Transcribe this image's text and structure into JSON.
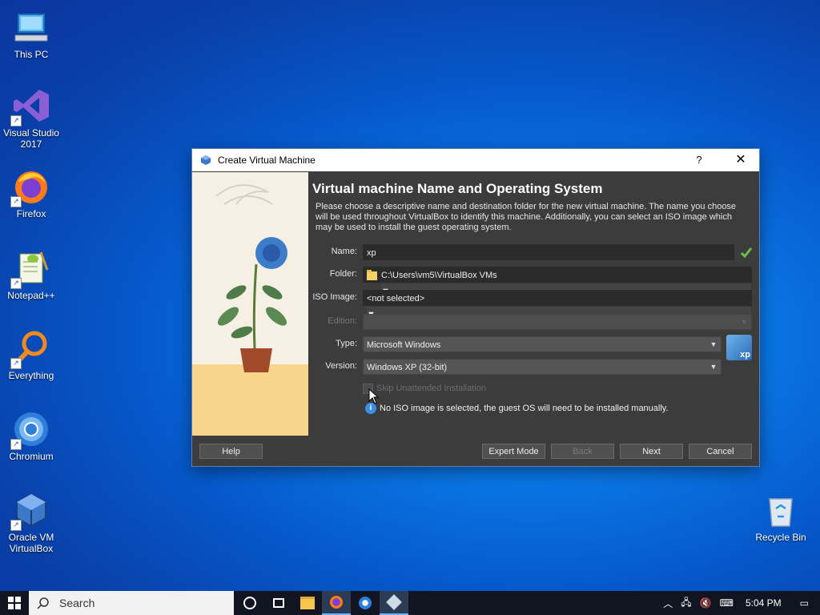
{
  "desktop": {
    "icons": [
      {
        "label": "This PC"
      },
      {
        "label": "Visual Studio 2017"
      },
      {
        "label": "Firefox"
      },
      {
        "label": "Notepad++"
      },
      {
        "label": "Everything"
      },
      {
        "label": "Chromium"
      },
      {
        "label": "Oracle VM VirtualBox"
      },
      {
        "label": "Recycle Bin"
      }
    ]
  },
  "dialog": {
    "title": "Create Virtual Machine",
    "help_glyph": "?",
    "close_glyph": "✕",
    "heading": "Virtual machine Name and Operating System",
    "description": "Please choose a descriptive name and destination folder for the new virtual machine. The name you choose will be used throughout VirtualBox to identify this machine. Additionally, you can select an ISO image which may be used to install the guest operating system.",
    "fields": {
      "name_label": "Name:",
      "name_value": "xp",
      "folder_label": "Folder:",
      "folder_value": "C:\\Users\\vm5\\VirtualBox VMs",
      "iso_label": "ISO Image:",
      "iso_value": "<not selected>",
      "edition_label": "Edition:",
      "edition_value": "",
      "type_label": "Type:",
      "type_value": "Microsoft Windows",
      "version_label": "Version:",
      "version_value": "Windows XP (32-bit)",
      "skip_label": "Skip Unattended Installation",
      "info_text": "No ISO image is selected, the guest OS will need to be installed manually.",
      "os_badge": "xp"
    },
    "buttons": {
      "help": "Help",
      "expert": "Expert Mode",
      "back": "Back",
      "next": "Next",
      "cancel": "Cancel"
    }
  },
  "taskbar": {
    "search_placeholder": "Search",
    "time": "5:04 PM"
  },
  "colors": {
    "accent_green": "#6cc04a",
    "info_blue": "#3b8fe6",
    "taskbar": "#101521"
  }
}
